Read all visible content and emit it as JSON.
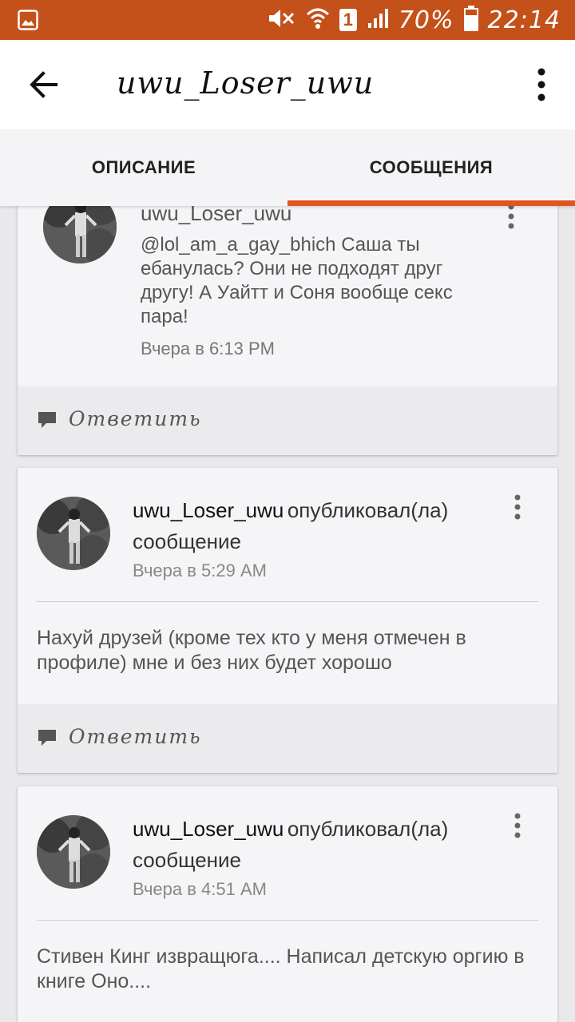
{
  "status_bar": {
    "battery": "70%",
    "time": "22:14",
    "sim": "1",
    "icons": [
      "image-icon",
      "mute-icon",
      "wifi-icon",
      "sim-icon",
      "signal-icon",
      "battery-icon"
    ]
  },
  "app_bar": {
    "title": "uwu_Loser_uwu"
  },
  "tabs": [
    {
      "label": "ОПИСАНИЕ",
      "active": false
    },
    {
      "label": "СООБЩЕНИЯ",
      "active": true
    }
  ],
  "accent_color": "#e0561f",
  "statusbar_color": "#c4501a",
  "posts": [
    {
      "author": "uwu_Loser_uwu",
      "text": "@lol_am_a_gay_bhich   Саша ты ебанулась? Они не подходят друг другу! А Уайтт и Соня вообще секс пара!",
      "time": "Вчера в 6:13 PM",
      "reply": "Ответить"
    },
    {
      "author": "uwu_Loser_uwu",
      "action": "опубликовал(ла) сообщение",
      "time": "Вчера в 5:29 AM",
      "text": "Нахуй друзей (кроме тех кто у меня отмечен в профиле) мне и без них будет хорошо",
      "reply": "Ответить"
    },
    {
      "author": "uwu_Loser_uwu",
      "action": "опубликовал(ла) сообщение",
      "time": "Вчера в 4:51 AM",
      "text": "Стивен Кинг извращюга.... Написал детскую оргию в книге Оно...."
    }
  ]
}
